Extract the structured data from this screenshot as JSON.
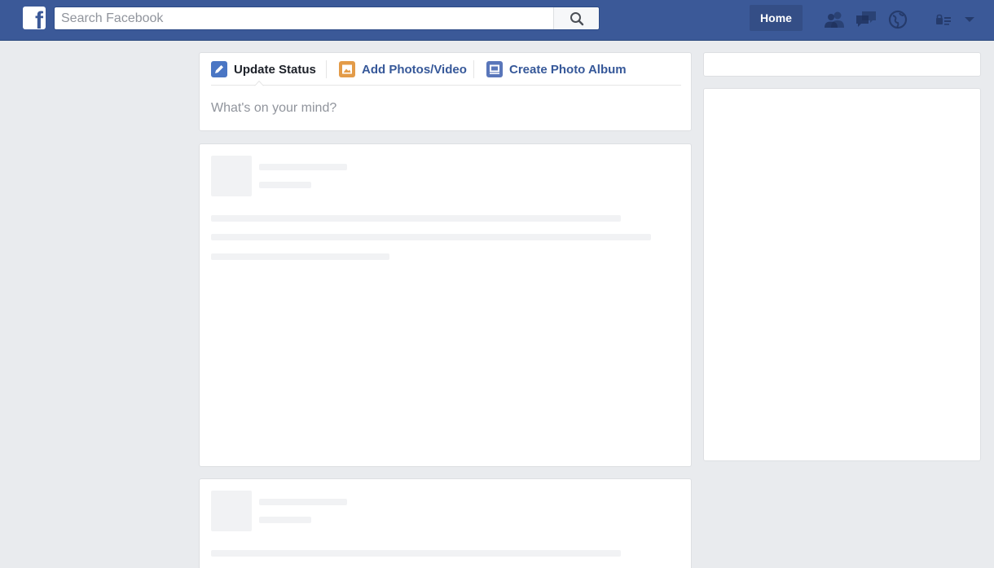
{
  "topbar": {
    "logo_icon": "facebook-f-logo",
    "search_placeholder": "Search Facebook",
    "search_icon": "search-icon",
    "home_label": "Home",
    "jewels": [
      "friend-requests-icon",
      "messages-icon",
      "notifications-globe-icon",
      "privacy-shortcuts-icon",
      "account-menu-chevron-down-icon"
    ]
  },
  "composer": {
    "tabs": [
      {
        "label": "Update Status",
        "icon": "pencil-icon",
        "active": true
      },
      {
        "label": "Add Photos/Video",
        "icon": "photo-icon",
        "active": false
      },
      {
        "label": "Create Photo Album",
        "icon": "album-icon",
        "active": false
      }
    ],
    "placeholder": "What's on your mind?"
  },
  "colors": {
    "brand_blue": "#3b5998",
    "home_button_bg": "#344e86",
    "page_bg": "#e9ebee",
    "link_blue": "#365899",
    "placeholder_gray": "#90949c",
    "skeleton_gray": "#f1f2f4"
  }
}
